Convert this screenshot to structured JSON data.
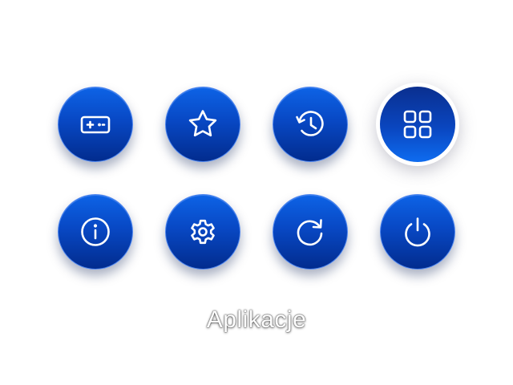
{
  "menu": {
    "selected_label": "Aplikacje",
    "accent_color": "#0848c4",
    "buttons": [
      {
        "icon": "gamepad-icon",
        "selected": false
      },
      {
        "icon": "star-icon",
        "selected": false
      },
      {
        "icon": "history-icon",
        "selected": false
      },
      {
        "icon": "apps-grid-icon",
        "selected": true
      },
      {
        "icon": "info-icon",
        "selected": false
      },
      {
        "icon": "gear-icon",
        "selected": false
      },
      {
        "icon": "refresh-icon",
        "selected": false
      },
      {
        "icon": "power-icon",
        "selected": false
      }
    ]
  }
}
